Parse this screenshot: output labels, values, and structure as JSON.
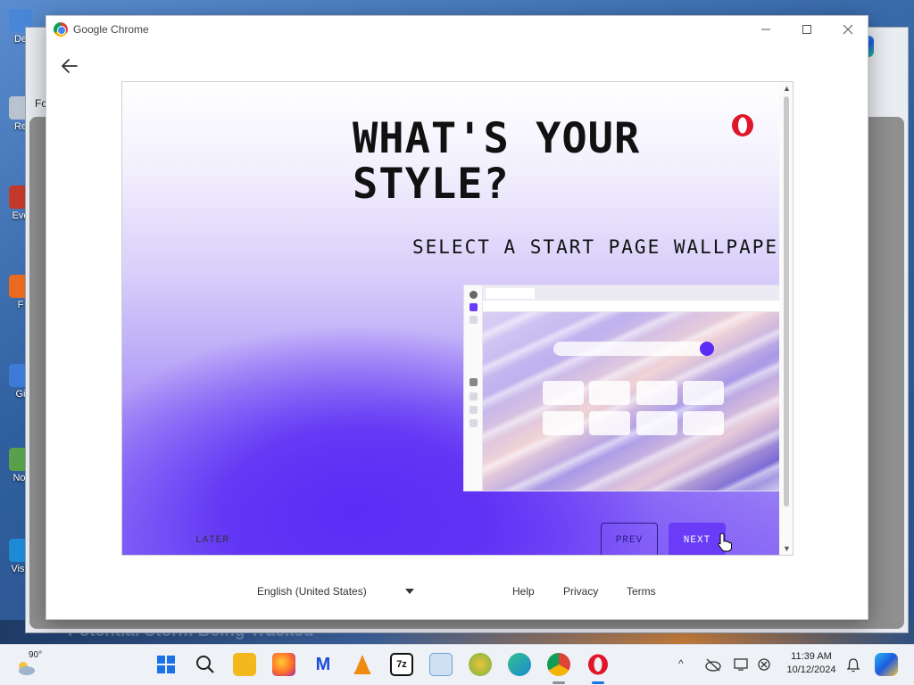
{
  "desktop": {
    "icons": [
      {
        "label": "De",
        "color": "#4a86d8"
      },
      {
        "label": "Re",
        "color": "#b9c3cf"
      },
      {
        "label": "Eve",
        "color": "#c0392b"
      },
      {
        "label": "F",
        "color": "#e86b1f"
      },
      {
        "label": "Gi",
        "color": "#3d7bd6"
      },
      {
        "label": "Not",
        "color": "#5aa04a"
      },
      {
        "label": "Visu",
        "color": "#1d8ad6"
      }
    ],
    "news_headline": "Potential Storm Being Tracked",
    "bg_window_label": "Fo"
  },
  "chrome": {
    "title": "Google Chrome",
    "minimize_icon": "minimize-icon",
    "maximize_icon": "maximize-icon",
    "close_icon": "close-icon"
  },
  "onboarding": {
    "headline_line1": "WHAT'S YOUR",
    "headline_line2": "STYLE?",
    "subtitle": "SELECT A START PAGE WALLPAPE",
    "later_label": "LATER",
    "prev_label": "PREV",
    "next_label": "NEXT",
    "brand_color": "#e0162b",
    "accent_color": "#6a3cf7"
  },
  "footer": {
    "language": "English (United States)",
    "help": "Help",
    "privacy": "Privacy",
    "terms": "Terms"
  },
  "taskbar": {
    "weather_temp": "90°",
    "time": "11:39 AM",
    "date": "10/12/2024",
    "apps": [
      {
        "name": "start-icon",
        "color": "#1a73e8"
      },
      {
        "name": "search-icon",
        "color": "#222"
      },
      {
        "name": "file-explorer-icon",
        "color": "#f2b81c"
      },
      {
        "name": "firefox-icon",
        "color": "#ff6d2a"
      },
      {
        "name": "malwarebytes-icon",
        "color": "#1e4bd6"
      },
      {
        "name": "vlc-icon",
        "color": "#f08a10"
      },
      {
        "name": "7zip-icon",
        "color": "#111"
      },
      {
        "name": "notepad-icon",
        "color": "#6aa0d8"
      },
      {
        "name": "canary-icon",
        "color": "#e9c33a"
      },
      {
        "name": "edge-icon",
        "color": "#1b8ad3"
      },
      {
        "name": "chrome-icon",
        "color": "#db4437"
      },
      {
        "name": "opera-icon",
        "color": "#e0162b"
      }
    ],
    "seven_zip_label": "7z"
  }
}
